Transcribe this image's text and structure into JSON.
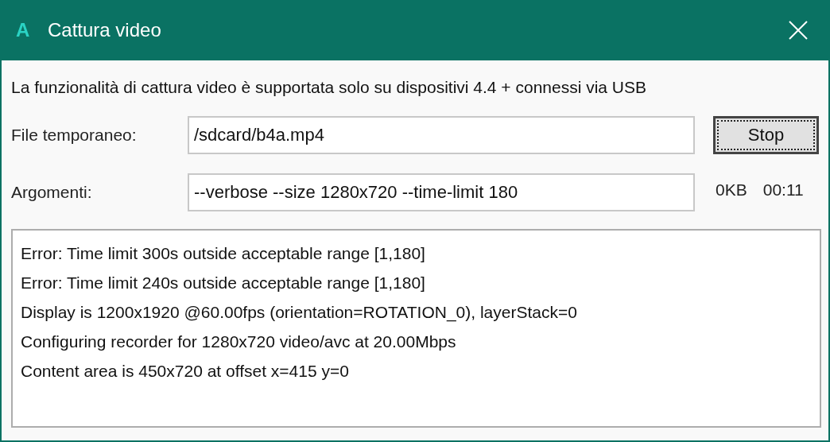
{
  "window": {
    "title": "Cattura video",
    "logo": "A"
  },
  "info": "La funzionalità di cattura video è supportata solo su dispositivi 4.4 + connessi via USB",
  "temp_file": {
    "label": "File temporaneo:",
    "value": "/sdcard/b4a.mp4"
  },
  "stop_button": {
    "label": "Stop",
    "focused": true
  },
  "arguments": {
    "label": "Argomenti:",
    "value": "--verbose --size 1280x720 --time-limit 180"
  },
  "size": "0KB",
  "elapsed": "00:11",
  "log": [
    "Error: Time limit 300s outside acceptable range [1,180]",
    "Error: Time limit 240s outside acceptable range [1,180]",
    "Display is 1200x1920 @60.00fps (orientation=ROTATION_0), layerStack=0",
    "Configuring recorder for 1280x720 video/avc at 20.00Mbps",
    "Content area is 450x720 at offset x=415 y=0"
  ]
}
